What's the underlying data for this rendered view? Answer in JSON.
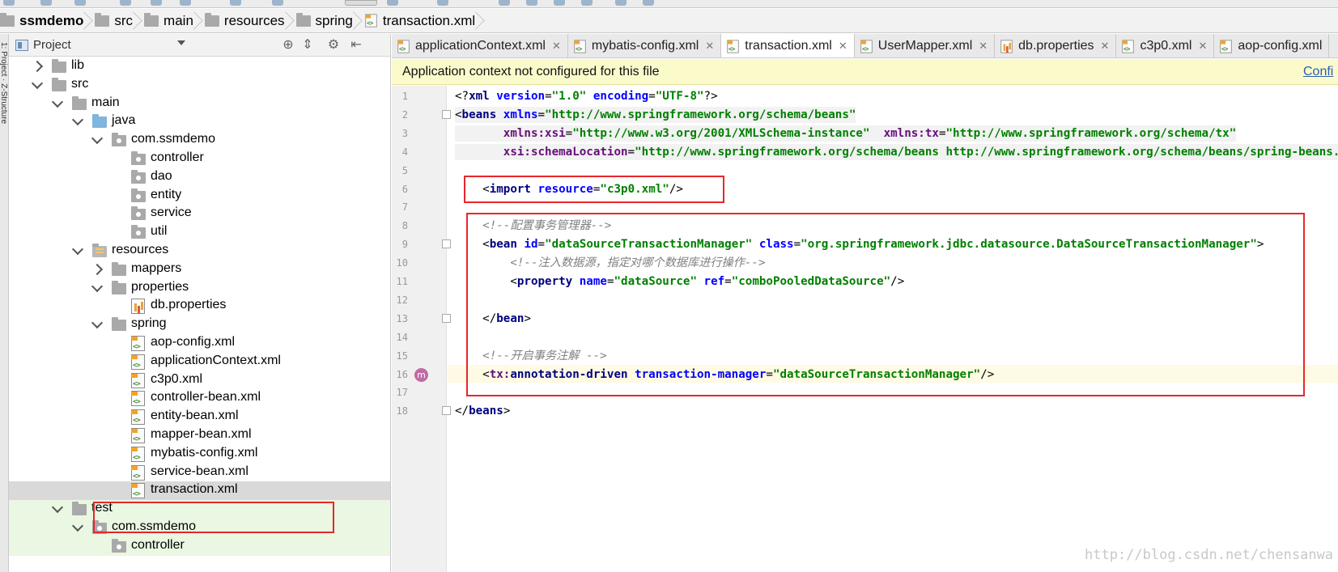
{
  "breadcrumb": [
    "ssmdemo",
    "src",
    "main",
    "resources",
    "spring",
    "transaction.xml"
  ],
  "project_panel": {
    "title": "Project",
    "tree": [
      {
        "label": "lib",
        "depth": 0,
        "state": "collapsed",
        "icon": "folder-icon"
      },
      {
        "label": "src",
        "depth": 0,
        "state": "expanded",
        "icon": "folder-icon"
      },
      {
        "label": "main",
        "depth": 1,
        "state": "expanded",
        "icon": "folder-icon"
      },
      {
        "label": "java",
        "depth": 2,
        "state": "expanded",
        "icon": "source-folder-icon"
      },
      {
        "label": "com.ssmdemo",
        "depth": 3,
        "state": "expanded",
        "icon": "package-icon"
      },
      {
        "label": "controller",
        "depth": 4,
        "state": "leaf",
        "icon": "package-icon"
      },
      {
        "label": "dao",
        "depth": 4,
        "state": "leaf",
        "icon": "package-icon"
      },
      {
        "label": "entity",
        "depth": 4,
        "state": "leaf",
        "icon": "package-icon"
      },
      {
        "label": "service",
        "depth": 4,
        "state": "leaf",
        "icon": "package-icon"
      },
      {
        "label": "util",
        "depth": 4,
        "state": "leaf",
        "icon": "package-icon"
      },
      {
        "label": "resources",
        "depth": 2,
        "state": "expanded",
        "icon": "resources-folder-icon"
      },
      {
        "label": "mappers",
        "depth": 3,
        "state": "collapsed",
        "icon": "folder-icon"
      },
      {
        "label": "properties",
        "depth": 3,
        "state": "expanded",
        "icon": "folder-icon"
      },
      {
        "label": "db.properties",
        "depth": 4,
        "state": "leaf",
        "icon": "properties-file-icon"
      },
      {
        "label": "spring",
        "depth": 3,
        "state": "expanded",
        "icon": "folder-icon"
      },
      {
        "label": "aop-config.xml",
        "depth": 4,
        "state": "leaf",
        "icon": "xml-file-icon"
      },
      {
        "label": "applicationContext.xml",
        "depth": 4,
        "state": "leaf",
        "icon": "xml-file-icon"
      },
      {
        "label": "c3p0.xml",
        "depth": 4,
        "state": "leaf",
        "icon": "xml-file-icon"
      },
      {
        "label": "controller-bean.xml",
        "depth": 4,
        "state": "leaf",
        "icon": "xml-file-icon"
      },
      {
        "label": "entity-bean.xml",
        "depth": 4,
        "state": "leaf",
        "icon": "xml-file-icon"
      },
      {
        "label": "mapper-bean.xml",
        "depth": 4,
        "state": "leaf",
        "icon": "xml-file-icon"
      },
      {
        "label": "mybatis-config.xml",
        "depth": 4,
        "state": "leaf",
        "icon": "xml-file-icon"
      },
      {
        "label": "service-bean.xml",
        "depth": 4,
        "state": "leaf",
        "icon": "xml-file-icon"
      },
      {
        "label": "transaction.xml",
        "depth": 4,
        "state": "leaf",
        "icon": "xml-file-icon",
        "selected": true
      },
      {
        "label": "test",
        "depth": 1,
        "state": "expanded",
        "icon": "test-folder-icon"
      },
      {
        "label": "com.ssmdemo",
        "depth": 2,
        "state": "expanded",
        "icon": "package-icon"
      },
      {
        "label": "controller",
        "depth": 3,
        "state": "leaf",
        "icon": "package-icon"
      }
    ]
  },
  "tabs": [
    {
      "label": "applicationContext.xml",
      "icon": "xml-file-icon"
    },
    {
      "label": "mybatis-config.xml",
      "icon": "xml-file-icon"
    },
    {
      "label": "transaction.xml",
      "icon": "xml-file-icon",
      "active": true
    },
    {
      "label": "UserMapper.xml",
      "icon": "xml-file-icon"
    },
    {
      "label": "db.properties",
      "icon": "properties-file-icon"
    },
    {
      "label": "c3p0.xml",
      "icon": "xml-file-icon"
    },
    {
      "label": "aop-config.xml",
      "icon": "xml-file-icon"
    }
  ],
  "notice": {
    "text": "Application context not configured for this file",
    "link": "Confi"
  },
  "editor": {
    "current_line": 16,
    "lines": [
      [
        [
          "punc",
          "<?"
        ],
        [
          "tag",
          "xml "
        ],
        [
          "attr",
          "version"
        ],
        [
          "punc",
          "="
        ],
        [
          "str",
          "\"1.0\" "
        ],
        [
          "attr",
          "encoding"
        ],
        [
          "punc",
          "="
        ],
        [
          "str",
          "\"UTF-8\""
        ],
        [
          "punc",
          "?>"
        ]
      ],
      [
        [
          "punc",
          "<"
        ],
        [
          "tag",
          "beans "
        ],
        [
          "attr",
          "xmlns"
        ],
        [
          "punc",
          "="
        ],
        [
          "str",
          "\"http://www.springframework.org/schema/beans\""
        ]
      ],
      [
        [
          "plain",
          "       "
        ],
        [
          "ns",
          "xmlns:xsi"
        ],
        [
          "punc",
          "="
        ],
        [
          "str",
          "\"http://www.w3.org/2001/XMLSchema-instance\"  "
        ],
        [
          "ns",
          "xmlns:tx"
        ],
        [
          "punc",
          "="
        ],
        [
          "str",
          "\"http://www.springframework.org/schema/tx\""
        ]
      ],
      [
        [
          "plain",
          "       "
        ],
        [
          "ns",
          "xsi:schemaLocation"
        ],
        [
          "punc",
          "="
        ],
        [
          "str",
          "\"http://www.springframework.org/schema/beans http://www.springframework.org/schema/beans/spring-beans.xsd\""
        ]
      ],
      [],
      [
        [
          "plain",
          "    "
        ],
        [
          "punc",
          "<"
        ],
        [
          "tag",
          "import "
        ],
        [
          "attr",
          "resource"
        ],
        [
          "punc",
          "="
        ],
        [
          "str",
          "\"c3p0.xml\""
        ],
        [
          "punc",
          "/>"
        ]
      ],
      [],
      [
        [
          "plain",
          "    "
        ],
        [
          "com",
          "<!--配置事务管理器-->"
        ]
      ],
      [
        [
          "plain",
          "    "
        ],
        [
          "punc",
          "<"
        ],
        [
          "tag",
          "bean "
        ],
        [
          "attr",
          "id"
        ],
        [
          "punc",
          "="
        ],
        [
          "str",
          "\"dataSourceTransactionManager\" "
        ],
        [
          "attr",
          "class"
        ],
        [
          "punc",
          "="
        ],
        [
          "str",
          "\"org.springframework.jdbc.datasource.DataSourceTransactionManager\""
        ],
        [
          "punc",
          ">"
        ]
      ],
      [
        [
          "plain",
          "        "
        ],
        [
          "com",
          "<!--注入数据源，指定对哪个数据库进行操作-->"
        ]
      ],
      [
        [
          "plain",
          "        "
        ],
        [
          "punc",
          "<"
        ],
        [
          "tag",
          "property "
        ],
        [
          "attr",
          "name"
        ],
        [
          "punc",
          "="
        ],
        [
          "str",
          "\"dataSource\" "
        ],
        [
          "attr",
          "ref"
        ],
        [
          "punc",
          "="
        ],
        [
          "str",
          "\"comboPooledDataSource\""
        ],
        [
          "punc",
          "/>"
        ]
      ],
      [],
      [
        [
          "plain",
          "    "
        ],
        [
          "punc",
          "</"
        ],
        [
          "tag",
          "bean"
        ],
        [
          "punc",
          ">"
        ]
      ],
      [],
      [
        [
          "plain",
          "    "
        ],
        [
          "com",
          "<!--开启事务注解 -->"
        ]
      ],
      [
        [
          "plain",
          "    "
        ],
        [
          "punc",
          "<"
        ],
        [
          "ns",
          "tx:"
        ],
        [
          "tag",
          "annotation-driven "
        ],
        [
          "attr",
          "transaction-manager"
        ],
        [
          "punc",
          "="
        ],
        [
          "str",
          "\"dataSourceTransactionManager\""
        ],
        [
          "punc",
          "/>"
        ]
      ],
      [],
      [
        [
          "punc",
          "</"
        ],
        [
          "tag",
          "beans"
        ],
        [
          "punc",
          ">"
        ]
      ]
    ]
  },
  "watermark": "http://blog.csdn.net/chensanwa",
  "colors": {
    "highlight_box": "#e8262a",
    "notice_bg": "#fbfacb",
    "selection": "#d9d9d9",
    "test_folder_bg": "#eaf7e2"
  }
}
